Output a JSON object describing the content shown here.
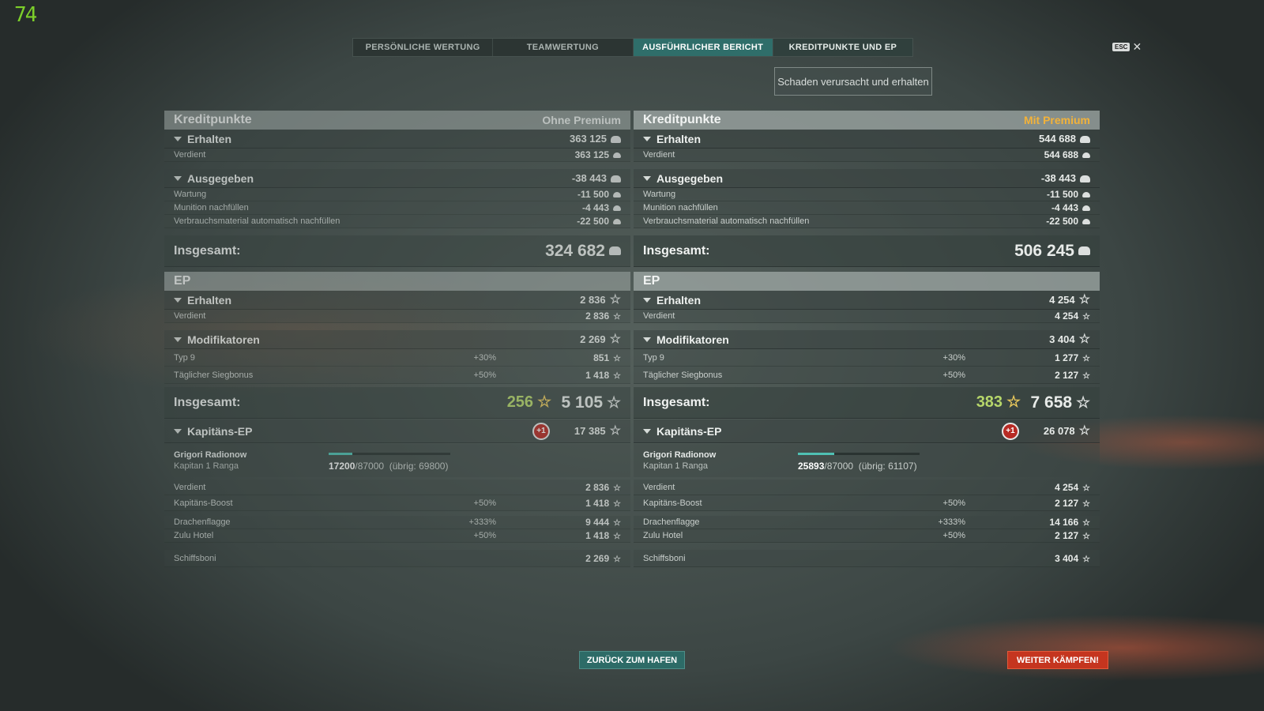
{
  "fps": "74",
  "tabs": [
    "PERSÖNLICHE WERTUNG",
    "TEAMWERTUNG",
    "AUSFÜHRLICHER BERICHT",
    "KREDITPUNKTE UND EP"
  ],
  "active_tab": 2,
  "esc": {
    "key": "ESC",
    "close": "✕"
  },
  "damage_button": "Schaden verursacht und erhalten",
  "panels": [
    {
      "kp_title": "Kreditpunkte",
      "premium_label": "Ohne Premium",
      "kp_earned_label": "Erhalten",
      "kp_earned_value": "363 125",
      "kp_verdient_label": "Verdient",
      "kp_verdient_value": "363 125",
      "kp_spent_label": "Ausgegeben",
      "kp_spent_value": "-38 443",
      "wartung_label": "Wartung",
      "wartung_value": "-11 500",
      "munition_label": "Munition nachfüllen",
      "munition_value": "-4 443",
      "verbrauch_label": "Verbrauchsmaterial automatisch nachfüllen",
      "verbrauch_value": "-22 500",
      "kp_total_label": "Insgesamt:",
      "kp_total_value": "324 682",
      "ep_title": "EP",
      "ep_earned_label": "Erhalten",
      "ep_earned_value": "2 836",
      "ep_verdient_label": "Verdient",
      "ep_verdient_value": "2 836",
      "mod_label": "Modifikatoren",
      "mod_value": "2 269",
      "typ_label": "Typ 9",
      "typ_pct": "+30%",
      "typ_value": "851",
      "sieg_label": "Täglicher Siegbonus",
      "sieg_pct": "+50%",
      "sieg_value": "1 418",
      "ep_total_label": "Insgesamt:",
      "ep_total_free": "256",
      "ep_total_value": "5 105",
      "cap_label": "Kapitäns-EP",
      "cap_badge": "+1",
      "cap_value": "17 385",
      "cap_name": "Grigori Radionow",
      "cap_rank": "Kapitan 1 Ranga",
      "cap_progress": 0.198,
      "cap_xp_current": "17200",
      "cap_xp_max": "/87000",
      "cap_xp_rest": "(übrig: 69800)",
      "cap_verdient_label": "Verdient",
      "cap_verdient_value": "2 836",
      "boost_label": "Kapitäns-Boost",
      "boost_pct": "+50%",
      "boost_value": "1 418",
      "flag1_label": "Drachenflagge",
      "flag1_pct": "+333%",
      "flag1_value": "9 444",
      "flag2_label": "Zulu Hotel",
      "flag2_pct": "+50%",
      "flag2_value": "1 418",
      "schiff_label": "Schiffsboni",
      "schiff_value": "2 269"
    },
    {
      "kp_title": "Kreditpunkte",
      "premium_label": "Mit Premium",
      "kp_earned_label": "Erhalten",
      "kp_earned_value": "544 688",
      "kp_verdient_label": "Verdient",
      "kp_verdient_value": "544 688",
      "kp_spent_label": "Ausgegeben",
      "kp_spent_value": "-38 443",
      "wartung_label": "Wartung",
      "wartung_value": "-11 500",
      "munition_label": "Munition nachfüllen",
      "munition_value": "-4 443",
      "verbrauch_label": "Verbrauchsmaterial automatisch nachfüllen",
      "verbrauch_value": "-22 500",
      "kp_total_label": "Insgesamt:",
      "kp_total_value": "506 245",
      "ep_title": "EP",
      "ep_earned_label": "Erhalten",
      "ep_earned_value": "4 254",
      "ep_verdient_label": "Verdient",
      "ep_verdient_value": "4 254",
      "mod_label": "Modifikatoren",
      "mod_value": "3 404",
      "typ_label": "Typ 9",
      "typ_pct": "+30%",
      "typ_value": "1 277",
      "sieg_label": "Täglicher Siegbonus",
      "sieg_pct": "+50%",
      "sieg_value": "2 127",
      "ep_total_label": "Insgesamt:",
      "ep_total_free": "383",
      "ep_total_value": "7 658",
      "cap_label": "Kapitäns-EP",
      "cap_badge": "+1",
      "cap_value": "26 078",
      "cap_name": "Grigori Radionow",
      "cap_rank": "Kapitan 1 Ranga",
      "cap_progress": 0.298,
      "cap_xp_current": "25893",
      "cap_xp_max": "/87000",
      "cap_xp_rest": "(übrig: 61107)",
      "cap_verdient_label": "Verdient",
      "cap_verdient_value": "4 254",
      "boost_label": "Kapitäns-Boost",
      "boost_pct": "+50%",
      "boost_value": "2 127",
      "flag1_label": "Drachenflagge",
      "flag1_pct": "+333%",
      "flag1_value": "14 166",
      "flag2_label": "Zulu Hotel",
      "flag2_pct": "+50%",
      "flag2_value": "2 127",
      "schiff_label": "Schiffsboni",
      "schiff_value": "3 404"
    }
  ],
  "back_button": "ZURÜCK ZUM HAFEN",
  "fight_button": "WEITER KÄMPFEN!",
  "colors": {
    "accent": "#2f6e6a",
    "premium": "#f2b23a",
    "free_xp": "#b6d66a",
    "fight": "#c5351f"
  }
}
